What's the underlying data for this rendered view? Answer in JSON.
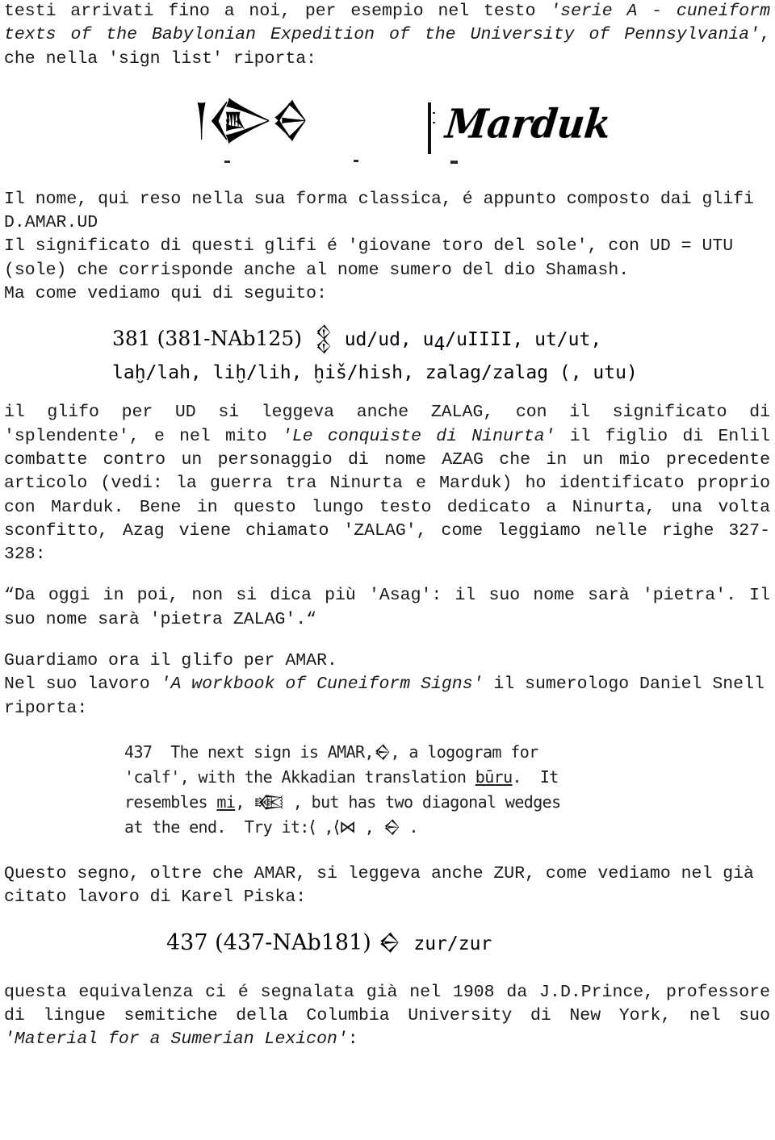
{
  "document": {
    "language": "it",
    "paragraphs": {
      "intro": {
        "line1": "testi arrivati fino a noi, per esempio nel testo ",
        "title_italic": "'serie A - cuneiform texts of the Babylonian Expedition of the University of Pennsylvania'",
        "line_end": ", che nella 'sign list' riporta:"
      },
      "after_marduk": "Il nome, qui reso nella sua forma classica, é appunto composto dai glifi D.AMAR.UD\nIl significato di questi glifi é 'giovane toro del sole', con UD = UTU (sole) che corrisponde anche al nome sumero del dio Shamash.\nMa come vediamo qui di seguito:",
      "after_381_a": "il glifo per UD si leggeva anche ZALAG, con il significato di 'splendente', e nel mito ",
      "after_381_italic": "'Le conquiste di Ninurta'",
      "after_381_b": " il figlio di Enlil combatte contro un personaggio di nome AZAG che in un mio precedente articolo (vedi: la guerra tra Ninurta e Marduk) ho identificato proprio con Marduk. Bene in questo lungo testo dedicato a Ninurta, una volta sconfitto, Azag viene chiamato 'ZALAG', come leggiamo nelle righe 327-328:",
      "quote": "“Da oggi in poi, non si dica più 'Asag': il suo nome sarà 'pietra'. Il suo nome sarà 'pietra ZALAG'.“",
      "amar_intro_a": "Guardiamo ora il glifo per AMAR.\nNel suo lavoro ",
      "amar_intro_italic": "'A workbook of Cuneiform Signs'",
      "amar_intro_b": " il sumerologo Daniel Snell riporta:",
      "after_437": "Questo segno, oltre che AMAR, si leggeva anche ZUR, come vediamo nel già citato lavoro di Karel Piska:",
      "closing_a": "questa equivalenza ci é segnalata già nel 1908 da J.D.Prince, professore di lingue semitiche della Columbia University di New York, nel suo ",
      "closing_italic": "'Material for a Sumerian Lexicon'",
      "closing_b": ":"
    }
  },
  "figures": {
    "marduk": {
      "caption_name": "cuneiform-marduk-scan",
      "cuneiform_glyphs": "𒁹𒀛𒀪",
      "transliteration": "Marduk"
    },
    "sign_381": {
      "caption_name": "piska-sign-381-scan",
      "number": "381",
      "reference": "(381-NAb125)",
      "glyph": "𒉭",
      "readings_line1": "ud/ud, u",
      "readings_line1_sub": "4",
      "readings_line1_rest": "/uIIII, ut/ut,",
      "readings_line2": "laḫ/lah, liḫ/lih, ḫiš/hish, zalag/zalag (, utu)"
    },
    "sign_437_snell": {
      "caption_name": "snell-sign-437-scan",
      "number": "437",
      "line1_a": "437  The next sign is AMAR,",
      "line1_glyph": "𒀪",
      "line1_b": ", a logogram for",
      "line2_a": "'calf', with the Akkadian translation ",
      "line2_underline": "būru",
      "line2_b": ".  It",
      "line3_a": "resembles ",
      "line3_underline": "mi",
      "line3_b": ", ",
      "line3_glyph": "𒀩",
      "line3_c": " , but has two diagonal wedges",
      "line4_a": "at the end.  Try it:",
      "line4_g1": "⟨",
      "line4_sep1": " ,",
      "line4_g2": "⟨⋈",
      "line4_sep2": " , ",
      "line4_g3": "𒀪",
      "line4_end": " ."
    },
    "sign_437_piska": {
      "caption_name": "piska-sign-437-scan",
      "number": "437",
      "reference": "(437-NAb181)",
      "glyph": "𒀪",
      "reading": "zur/zur"
    }
  },
  "colors": {
    "page_background": "#ffffff",
    "body_text": "#1a1a1a",
    "scan_text": "#2a2a2a",
    "scan_serif_text": "#16161e"
  }
}
